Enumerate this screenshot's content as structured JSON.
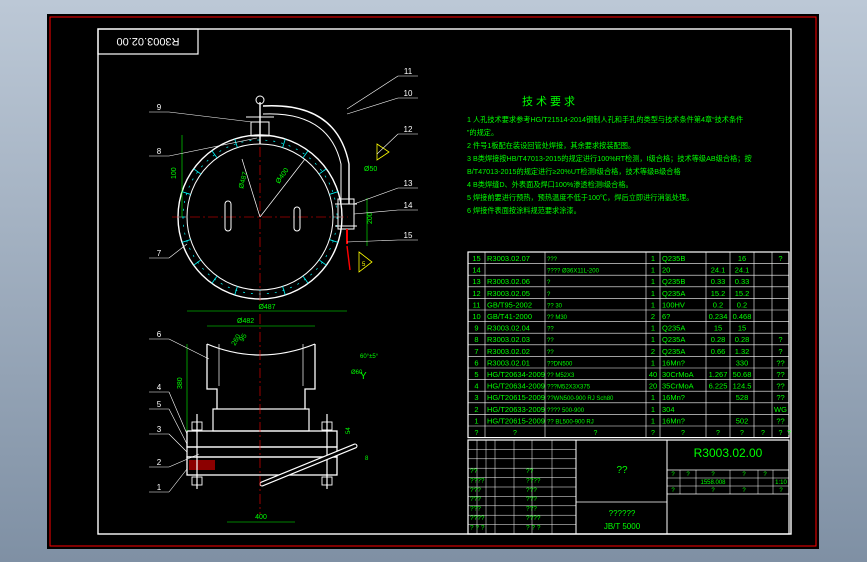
{
  "drawing": {
    "code_rotated": "R3003.02.00",
    "tech_title": "技术要求",
    "tech_lines": [
      "1  人孔技术要求参考HG/T21514-2014钢制人孔和手孔的类型与技术条件第4章“技术条件",
      "   ”的规定。",
      "2  件号1板配在装设回管处焊接，其余要求按装配图。",
      "3  B类焊接按HB/T47013-2015的规定进行100%RT检测，I级合格；技术等级AB级合格；按",
      "   B/T47013-2015的规定进行≥20%UT检测I级合格，技术等级B级合格",
      "4  B类焊缝D、外表面及焊口100%渗透检测I级合格。",
      "5  焊接前要进行预热，预热温度不低于100℃，焊后立即进行消氢处理。",
      "6  焊接件表面按涂料规范要求涂漆。"
    ],
    "balloons": [
      "11",
      "10",
      "9",
      "12",
      "8",
      "13",
      "14",
      "15",
      "7",
      "6",
      "4",
      "5",
      "3",
      "2",
      "1"
    ],
    "dims": [
      "Ø487",
      "Ø400",
      "Ø50",
      "100",
      "200",
      "5",
      "260",
      "380",
      "Ø482",
      "95",
      "Ø60",
      "60°±5°",
      "54",
      "8",
      "400"
    ],
    "weld_mark": "Y"
  },
  "bom": {
    "rows": [
      {
        "no": "15",
        "code": "R3003.02.07",
        "name": "???",
        "qty": "1",
        "mat": "Q235B",
        "w1": "",
        "w2": "16",
        "note": "?"
      },
      {
        "no": "14",
        "code": "",
        "name": "???? Ø36X11L-200",
        "qty": "1",
        "mat": "20",
        "w1": "24.1",
        "w2": "24.1",
        "note": ""
      },
      {
        "no": "13",
        "code": "R3003.02.06",
        "name": "?",
        "qty": "1",
        "mat": "Q235B",
        "w1": "0.33",
        "w2": "0.33",
        "note": ""
      },
      {
        "no": "12",
        "code": "R3003.02.05",
        "name": "?",
        "qty": "1",
        "mat": "Q235A",
        "w1": "15.2",
        "w2": "15.2",
        "note": ""
      },
      {
        "no": "11",
        "code": "GB/T95-2002",
        "name": "?? 30",
        "qty": "1",
        "mat": "100HV",
        "w1": "0.2",
        "w2": "0.2",
        "note": ""
      },
      {
        "no": "10",
        "code": "GB/T41-2000",
        "name": "?? M30",
        "qty": "2",
        "mat": "6?",
        "w1": "0.234",
        "w2": "0.468",
        "note": ""
      },
      {
        "no": "9",
        "code": "R3003.02.04",
        "name": "??",
        "qty": "1",
        "mat": "Q235A",
        "w1": "15",
        "w2": "15",
        "note": ""
      },
      {
        "no": "8",
        "code": "R3003.02.03",
        "name": "??",
        "qty": "1",
        "mat": "Q235A",
        "w1": "0.28",
        "w2": "0.28",
        "note": "?"
      },
      {
        "no": "7",
        "code": "R3003.02.02",
        "name": "??",
        "qty": "2",
        "mat": "Q235A",
        "w1": "0.66",
        "w2": "1.32",
        "note": "?"
      },
      {
        "no": "6",
        "code": "R3003.02.01",
        "name": "??DN500",
        "qty": "1",
        "mat": "16Mn?",
        "w1": "",
        "w2": "330",
        "note": "??"
      },
      {
        "no": "5",
        "code": "HG/T20634-2009",
        "name": "?? M52X3",
        "qty": "40",
        "mat": "30CrMoA",
        "w1": "1.267",
        "w2": "50.68",
        "note": "??"
      },
      {
        "no": "4",
        "code": "HG/T20634-2009",
        "name": "???M52X3X375",
        "qty": "20",
        "mat": "35CrMoA",
        "w1": "6.225",
        "w2": "124.5",
        "note": "??"
      },
      {
        "no": "3",
        "code": "HG/T20615-2009",
        "name": "??WN500-900 RJ Sch80",
        "qty": "1",
        "mat": "16Mn?",
        "w1": "",
        "w2": "528",
        "note": "??"
      },
      {
        "no": "2",
        "code": "HG/T20633-2009",
        "name": "???? 500-900",
        "qty": "1",
        "mat": "304",
        "w1": "",
        "w2": "",
        "note": "WG"
      },
      {
        "no": "1",
        "code": "HG/T20615-2009",
        "name": "?? BL500-900 RJ",
        "qty": "1",
        "mat": "16Mn?",
        "w1": "",
        "w2": "502",
        "note": "??"
      }
    ],
    "header": [
      "?",
      "?",
      "?",
      "?",
      "?",
      "?",
      "?",
      "?",
      "?",
      "?"
    ]
  },
  "titleblock": {
    "code": "R3003.02.00",
    "name": "??",
    "company": "??????",
    "standard": "JB/T 5000",
    "scale": "1:10",
    "weight": "1558.008",
    "small": [
      "?",
      "?",
      "?",
      "?",
      "?",
      "?",
      "?",
      "?",
      "?"
    ],
    "left_rows": [
      "??",
      "????",
      "???",
      "???",
      "???",
      "????",
      "? ? ?"
    ]
  },
  "colors": {
    "line": "#ffffff",
    "green": "#00ff00",
    "red": "#ff0000",
    "yellow": "#ffff00",
    "cyan": "#00ffff",
    "magenta": "#ff00ff"
  }
}
